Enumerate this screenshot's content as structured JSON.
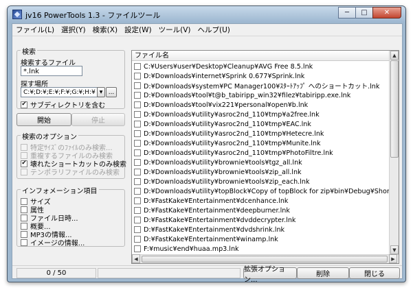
{
  "window": {
    "title": "jv16 PowerTools 1.3 - ファイルツール",
    "minimize_glyph": "─",
    "maximize_glyph": "□",
    "close_glyph": "✕"
  },
  "menu": [
    "ファイル(L)",
    "選択(Y)",
    "検索(X)",
    "設定(W)",
    "ツール(V)",
    "ヘルプ(U)"
  ],
  "search": {
    "group_title": "検索",
    "file_label": "検索するファイル",
    "file_value": "*.lnk",
    "location_label": "探す場所",
    "location_value": "C:¥;D:¥;E:¥;F:¥;G:¥;H:¥",
    "location_btn_arrow": "▼",
    "browse_btn": "...",
    "include_subdirs_label": "サブディレクトリを含む",
    "include_subdirs_checked": true,
    "start_button": "開始",
    "stop_button": "停止"
  },
  "options": {
    "group_title": "検索のオプション",
    "items": [
      {
        "label": "特定ｻｲｽﾞのﾌｧｲﾙのみ検索...",
        "checked": false,
        "disabled": true
      },
      {
        "label": "重複するファイルのみ検索",
        "checked": false,
        "disabled": true
      },
      {
        "label": "壊れたショートカットのみ検索",
        "checked": true,
        "disabled": false
      },
      {
        "label": "テンポラリファイルのみ検索",
        "checked": false,
        "disabled": true
      }
    ]
  },
  "info": {
    "group_title": "インフォメーション項目",
    "items": [
      "サイズ",
      "属性",
      "ファイル日時...",
      "概要...",
      "MP3の情報...",
      "イメージの情報..."
    ]
  },
  "file_list": {
    "column_header": "ファイル名",
    "rows": [
      "C:¥Users¥user¥Desktop¥Cleanup¥AVG Free 8.5.lnk",
      "D:¥Downloads¥internet¥Sprink 0.677¥Sprink.lnk",
      "D:¥Downloads¥system¥PC Manager100¥ｽﾀｰﾄｱｯﾌﾟ へのショートカット.lnk",
      "D:¥Downloads¥tool¥t@b_tabiripp_win32¥filez¥tabiripp.exe.lnk",
      "D:¥Downloads¥tool¥vix221¥personal¥open¥b.lnk",
      "D:¥Downloads¥utility¥asroc2nd_110¥tmp¥a2free.lnk",
      "D:¥Downloads¥utility¥asroc2nd_110¥tmp¥EAC.lnk",
      "D:¥Downloads¥utility¥asroc2nd_110¥tmp¥Hetecre.lnk",
      "D:¥Downloads¥utility¥asroc2nd_110¥tmp¥Munite.lnk",
      "D:¥Downloads¥utility¥asroc2nd_110¥tmp¥PhotoFiltre.lnk",
      "D:¥Downloads¥utility¥brownie¥tools¥tgz_all.lnk",
      "D:¥Downloads¥utility¥brownie¥tools¥zip_all.lnk",
      "D:¥Downloads¥utility¥brownie¥tools¥zip_each.lnk",
      "D:¥Downloads¥utility¥topBlock¥Copy of topBlock for zip¥bin¥Debug¥Shortcut to top",
      "D:¥FastKake¥Entertainment¥dcenhance.lnk",
      "D:¥FastKake¥Entertainment¥deepburner.lnk",
      "D:¥FastKake¥Entertainment¥dvddecrypter.lnk",
      "D:¥FastKake¥Entertainment¥dvdshrink.lnk",
      "D:¥FastKake¥Entertainment¥winamp.lnk",
      "F:¥music¥end¥huaa.mp3.lnk"
    ]
  },
  "status": {
    "count": "0 / 50",
    "extended_options_button": "拡張オプション...",
    "delete_button": "削除",
    "close_button": "閉じる"
  }
}
